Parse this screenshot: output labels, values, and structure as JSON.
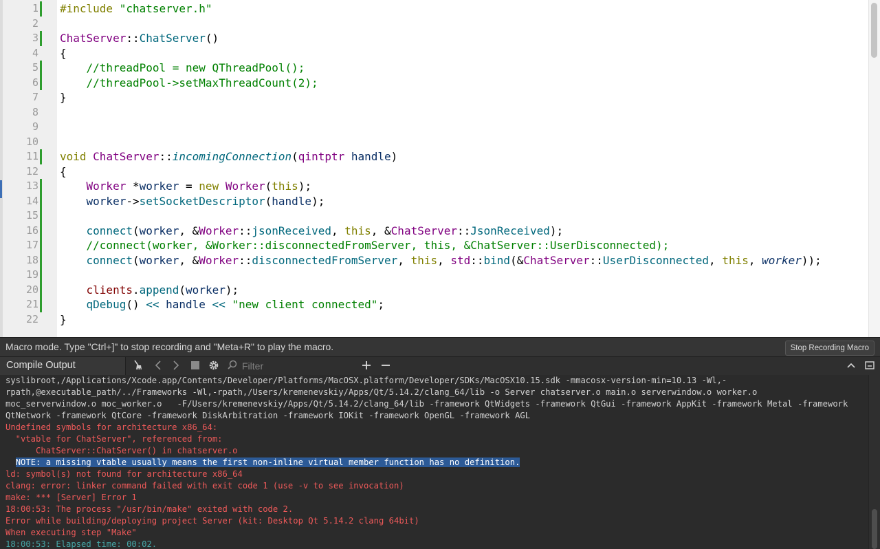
{
  "editor": {
    "line_numbers": [
      "1",
      "2",
      "3",
      "4",
      "5",
      "6",
      "7",
      "8",
      "9",
      "10",
      "11",
      "12",
      "13",
      "14",
      "15",
      "16",
      "17",
      "18",
      "19",
      "20",
      "21",
      "22"
    ],
    "code": {
      "l1_directive": "#include",
      "l1_file": "\"chatserver.h\"",
      "l3_class": "ChatServer",
      "l3_sep": "::",
      "l3_ctor": "ChatServer",
      "l3_parens": "()",
      "open_brace": "{",
      "close_brace": "}",
      "l5_comment": "    //threadPool = new QThreadPool();",
      "l6_comment": "    //threadPool->setMaxThreadCount(2);",
      "l11_void": "void",
      "l11_class": "ChatServer",
      "l11_sep": "::",
      "l11_func": "incomingConnection",
      "l11_open": "(",
      "l11_type": "qintptr",
      "l11_param": " handle",
      "l11_close": ")",
      "l13_indent": "    ",
      "l13_type": "Worker",
      "l13_star": " *",
      "l13_var": "worker",
      "l13_eq": " = ",
      "l13_new": "new",
      "l13_sp": " ",
      "l13_ctor": "Worker",
      "l13_open": "(",
      "l13_this": "this",
      "l13_close": ");",
      "l14_indent": "    ",
      "l14_var": "worker",
      "l14_arrow": "->",
      "l14_func": "setSocketDescriptor",
      "l14_open": "(",
      "l14_arg": "handle",
      "l14_close": ");",
      "l16_indent": "    ",
      "l16_connect": "connect",
      "l16_p1": "(",
      "l16_worker": "worker",
      "l16_p2": ", &",
      "l16_wcls": "Worker",
      "l16_sep1": "::",
      "l16_sig": "jsonReceived",
      "l16_p3": ", ",
      "l16_this": "this",
      "l16_p4": ", &",
      "l16_ccls": "ChatServer",
      "l16_sep2": "::",
      "l16_slot": "JsonReceived",
      "l16_p5": ");",
      "l17_comment": "    //connect(worker, &Worker::disconnectedFromServer, this, &ChatServer::UserDisconnected);",
      "l18_indent": "    ",
      "l18_connect": "connect",
      "l18_p1": "(",
      "l18_worker": "worker",
      "l18_p2": ", &",
      "l18_wcls": "Worker",
      "l18_sep1": "::",
      "l18_sig": "disconnectedFromServer",
      "l18_p3": ", ",
      "l18_this": "this",
      "l18_p4": ", ",
      "l18_std": "std",
      "l18_sep2": "::",
      "l18_bind": "bind",
      "l18_p5": "(&",
      "l18_ccls": "ChatServer",
      "l18_sep3": "::",
      "l18_slot": "UserDisconnected",
      "l18_p6": ", ",
      "l18_this2": "this",
      "l18_p7": ", ",
      "l18_worker2": "worker",
      "l18_p8": "));",
      "l20_indent": "    ",
      "l20_member": "clients",
      "l20_dot": ".",
      "l20_func": "append",
      "l20_open": "(",
      "l20_arg": "worker",
      "l20_close": ");",
      "l21_indent": "    ",
      "l21_func": "qDebug",
      "l21_parens": "()",
      "l21_op1": " << ",
      "l21_arg": "handle",
      "l21_op2": " << ",
      "l21_str": "\"new client connected\"",
      "l21_end": ";"
    }
  },
  "macro_bar": {
    "message": "Macro mode. Type \"Ctrl+]\" to stop recording and \"Meta+R\" to play the macro.",
    "stop_button": "Stop Recording Macro"
  },
  "output_pane": {
    "title": "Compile Output",
    "filter_placeholder": "Filter",
    "icons": [
      "clean-icon",
      "previous-icon",
      "next-icon",
      "stop-icon",
      "settings-icon",
      "search-icon",
      "add-icon",
      "minimize-icon",
      "collapse-icon",
      "maximize-icon"
    ],
    "lines": {
      "l1": "syslibroot,/Applications/Xcode.app/Contents/Developer/Platforms/MacOSX.platform/Developer/SDKs/MacOSX10.15.sdk -mmacosx-version-min=10.13 -Wl,-",
      "l2": "rpath,@executable_path/../Frameworks -Wl,-rpath,/Users/kremenevskiy/Apps/Qt/5.14.2/clang_64/lib -o Server chatserver.o main.o serverwindow.o worker.o",
      "l3": "moc_serverwindow.o moc_worker.o   -F/Users/kremenevskiy/Apps/Qt/5.14.2/clang_64/lib -framework QtWidgets -framework QtGui -framework AppKit -framework Metal -framework",
      "l4": "QtNetwork -framework QtCore -framework DiskArbitration -framework IOKit -framework OpenGL -framework AGL",
      "l5": "Undefined symbols for architecture x86_64:",
      "l6": "  \"vtable for ChatServer\", referenced from:",
      "l7": "      ChatServer::ChatServer() in chatserver.o",
      "l8_prefix": "  ",
      "l8_selected": "NOTE: a missing vtable usually means the first non-inline virtual member function has no definition.",
      "l9": "ld: symbol(s) not found for architecture x86_64",
      "l10": "clang: error: linker command failed with exit code 1 (use -v to see invocation)",
      "l11": "make: *** [Server] Error 1",
      "l12": "18:00:53: The process \"/usr/bin/make\" exited with code 2.",
      "l13": "Error while building/deploying project Server (kit: Desktop Qt 5.14.2 clang 64bit)",
      "l14": "When executing step \"Make\"",
      "l15": "18:00:53: Elapsed time: 00:02."
    }
  }
}
